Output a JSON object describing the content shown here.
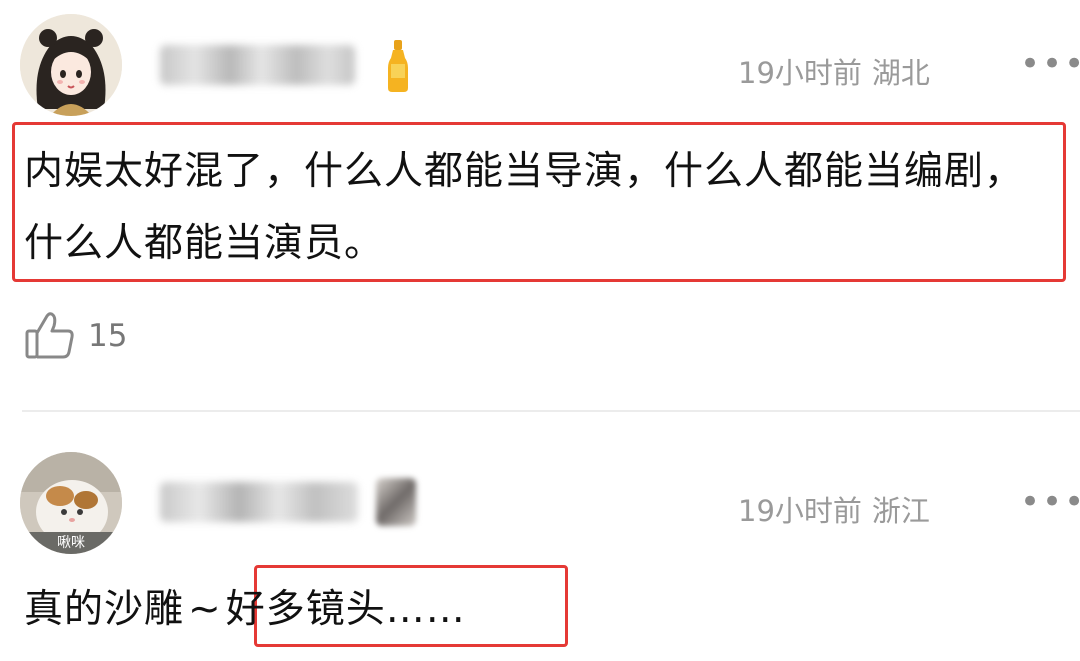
{
  "comments": [
    {
      "time": "19小时前",
      "location": "湖北",
      "content": "内娱太好混了，什么人都能当导演，什么人都能当编剧，什么人都能当演员。",
      "likes": "15",
      "more": "•••"
    },
    {
      "time": "19小时前",
      "location": "浙江",
      "content_prefix": "真的沙雕",
      "tilde": "~",
      "content_highlight": "好多镜头……",
      "avatar_text": "啾咪",
      "more": "•••"
    }
  ],
  "colors": {
    "highlight_border": "#e53935",
    "meta_text": "#9a9a9a"
  }
}
